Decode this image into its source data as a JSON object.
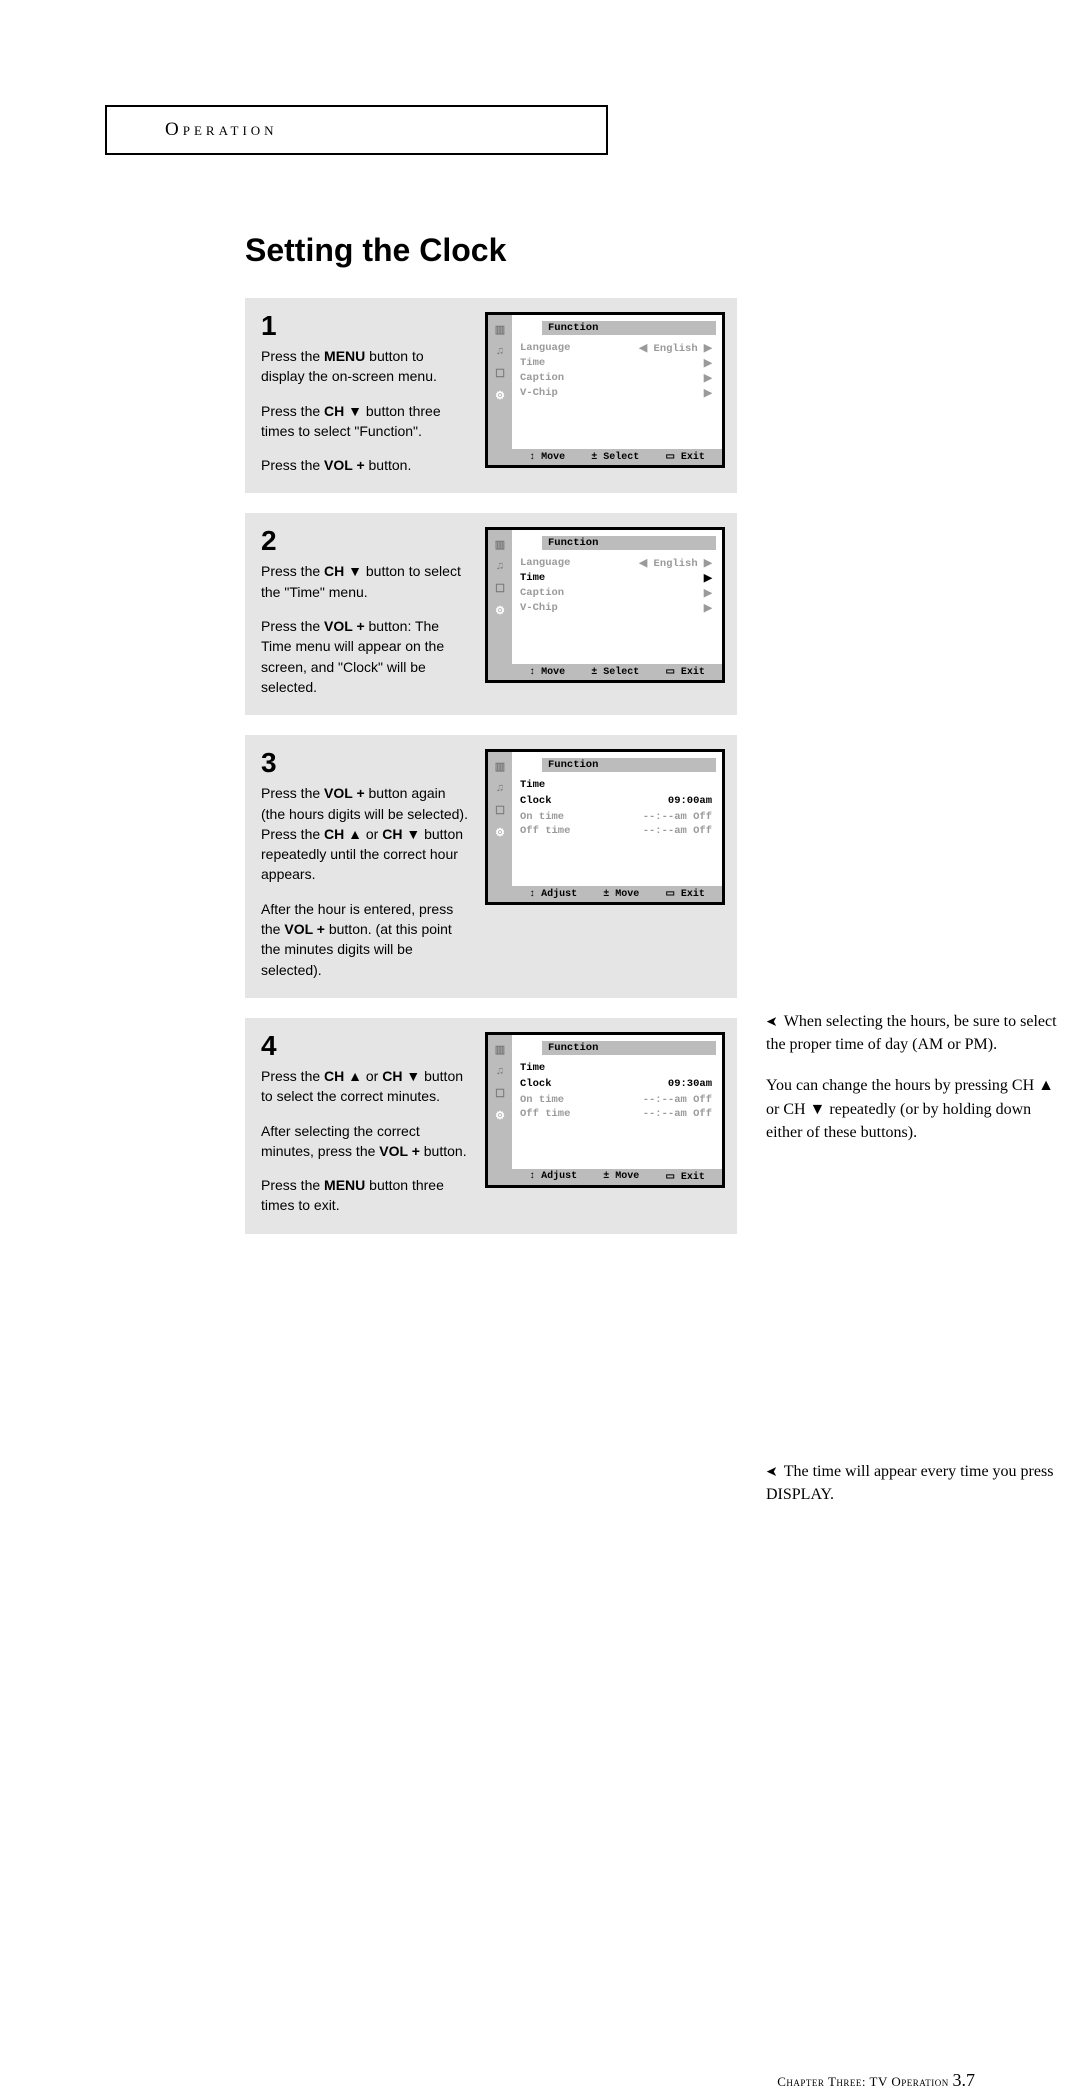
{
  "header": {
    "section": "Operation"
  },
  "title": "Setting the Clock",
  "steps": [
    {
      "num": "1",
      "paras": [
        [
          {
            "t": "Press the "
          },
          {
            "t": "MENU",
            "b": true
          },
          {
            "t": " button to display the on-screen menu."
          }
        ],
        [
          {
            "t": "Press the "
          },
          {
            "t": "CH ▼",
            "b": true
          },
          {
            "t": " button three times to select \"Function\"."
          }
        ],
        [
          {
            "t": "Press the "
          },
          {
            "t": "VOL +",
            "b": true
          },
          {
            "t": " button."
          }
        ]
      ],
      "osd": {
        "title": "Function",
        "rows": [
          {
            "l": "Language",
            "v": "◀ English ▶",
            "em": false
          },
          {
            "l": "Time",
            "v": "▶",
            "em": false
          },
          {
            "l": "Caption",
            "v": "▶",
            "em": false
          },
          {
            "l": "V-Chip",
            "v": "▶",
            "em": false
          }
        ],
        "footer": [
          "↕ Move",
          "± Select",
          "▭ Exit"
        ],
        "activeIcon": 3
      }
    },
    {
      "num": "2",
      "paras": [
        [
          {
            "t": "Press the "
          },
          {
            "t": "CH ▼",
            "b": true
          },
          {
            "t": " button to select the \"Time\" menu."
          }
        ],
        [
          {
            "t": "Press the "
          },
          {
            "t": "VOL +",
            "b": true
          },
          {
            "t": " button: The Time menu will appear on the screen, and \"Clock\" will be selected."
          }
        ]
      ],
      "osd": {
        "title": "Function",
        "rows": [
          {
            "l": "Language",
            "v": "◀ English ▶",
            "em": false
          },
          {
            "l": "Time",
            "v": "▶",
            "em": true
          },
          {
            "l": "Caption",
            "v": "▶",
            "em": false
          },
          {
            "l": "V-Chip",
            "v": "▶",
            "em": false
          }
        ],
        "footer": [
          "↕ Move",
          "± Select",
          "▭ Exit"
        ],
        "activeIcon": 3
      }
    },
    {
      "num": "3",
      "paras": [
        [
          {
            "t": "Press the "
          },
          {
            "t": "VOL +",
            "b": true
          },
          {
            "t": " button again (the hours digits will be selected). Press the "
          },
          {
            "t": "CH ▲",
            "b": true
          },
          {
            "t": " or "
          },
          {
            "t": "CH ▼",
            "b": true
          },
          {
            "t": " button repeatedly until the correct hour appears."
          }
        ],
        [
          {
            "t": "After the hour is entered, press the "
          },
          {
            "t": "VOL +",
            "b": true
          },
          {
            "t": " button. (at this point the minutes digits will be selected)."
          }
        ]
      ],
      "osd": {
        "title": "Function",
        "rows": [
          {
            "l": "Time",
            "v": "",
            "em": true
          },
          {
            "l": "",
            "v": "",
            "em": false
          },
          {
            "l": "Clock",
            "v": "09:00am",
            "em": true
          },
          {
            "l": "",
            "v": "",
            "em": false
          },
          {
            "l": "On time",
            "v": "--:--am Off",
            "em": false
          },
          {
            "l": "Off time",
            "v": "--:--am Off",
            "em": false
          }
        ],
        "footer": [
          "↕ Adjust",
          "± Move",
          "▭ Exit"
        ],
        "activeIcon": 3
      }
    },
    {
      "num": "4",
      "paras": [
        [
          {
            "t": "Press the "
          },
          {
            "t": "CH ▲",
            "b": true
          },
          {
            "t": " or "
          },
          {
            "t": "CH ▼",
            "b": true
          },
          {
            "t": " button to select the correct minutes."
          }
        ],
        [
          {
            "t": "After selecting the correct minutes, press the "
          },
          {
            "t": "VOL +",
            "b": true
          },
          {
            "t": " button."
          }
        ],
        [
          {
            "t": "Press the "
          },
          {
            "t": "MENU",
            "b": true
          },
          {
            "t": " button three times to exit."
          }
        ]
      ],
      "osd": {
        "title": "Function",
        "rows": [
          {
            "l": "Time",
            "v": "",
            "em": true
          },
          {
            "l": "",
            "v": "",
            "em": false
          },
          {
            "l": "Clock",
            "v": "09:30am",
            "em": true
          },
          {
            "l": "",
            "v": "",
            "em": false
          },
          {
            "l": "On time",
            "v": "--:--am Off",
            "em": false
          },
          {
            "l": "Off time",
            "v": "--:--am Off",
            "em": false
          }
        ],
        "footer": [
          "↕ Adjust",
          "± Move",
          "▭ Exit"
        ],
        "activeIcon": 3
      }
    }
  ],
  "notes_step3": [
    "When selecting the hours, be sure to select the proper time of day (AM or PM).",
    "You can change the hours by pressing CH ▲ or CH ▼ repeatedly (or by holding down either of these buttons)."
  ],
  "notes_step4": [
    "The time will appear every time you press DISPLAY."
  ],
  "footer": {
    "chapter": "Chapter Three: TV Operation ",
    "page": "3.7"
  },
  "osd_icons": [
    "▥",
    "♫",
    "☐",
    "⚙"
  ]
}
